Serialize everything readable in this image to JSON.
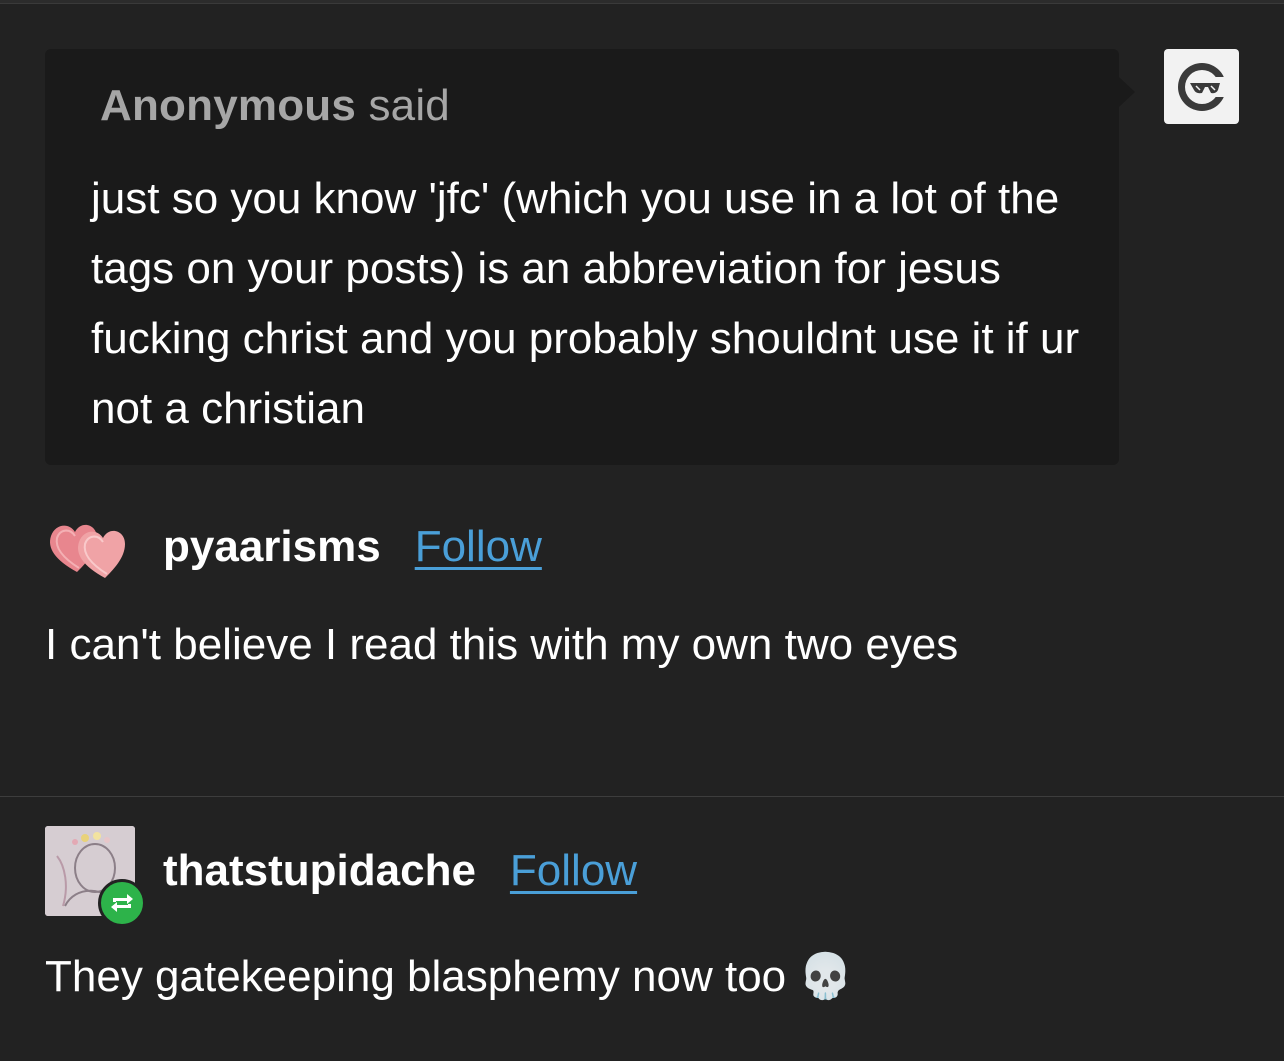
{
  "ask": {
    "asker_name": "Anonymous",
    "asker_suffix": " said",
    "question": "just so you know 'jfc' (which you use in a lot of the tags on your posts) is an abbreviation for jesus fucking christ and you probably shouldnt use it if ur not a christian"
  },
  "posts": [
    {
      "username": "pyaarisms",
      "follow_label": "Follow",
      "text": "I can't believe I read this with my own two eyes",
      "avatar_icon": "pink-macaron-hearts-icon"
    },
    {
      "username": "thatstupidache",
      "follow_label": "Follow",
      "text": "They gatekeeping blasphemy now too",
      "emoji": "💀",
      "avatar_icon": "sketch-portrait-avatar",
      "badge_icon": "reblog-icon"
    }
  ],
  "colors": {
    "background": "#222222",
    "ask_bubble": "#1a1a1a",
    "follow_link": "#4a9fd8",
    "reblog_badge": "#2db34a"
  }
}
